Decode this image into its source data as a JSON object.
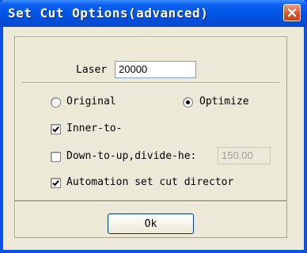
{
  "window": {
    "title": "Set Cut Options(advanced)",
    "close_icon": "close-icon"
  },
  "laser": {
    "label": "Laser",
    "value": "20000"
  },
  "mode": {
    "options": [
      {
        "label": "Original",
        "selected": false
      },
      {
        "label": "Optimize",
        "selected": true
      }
    ]
  },
  "options": {
    "inner_to": {
      "label": "Inner-to-",
      "checked": true
    },
    "down_to_up": {
      "label": "Down-to-up,divide-he:",
      "checked": false,
      "value": "150.00"
    },
    "automation": {
      "label": "Automation set cut director",
      "checked": true
    }
  },
  "ok_button": {
    "label": "Ok"
  },
  "colors": {
    "titlebar": "#0053e1",
    "dialog_bg": "#ece9d8",
    "close_button": "#e0522b"
  }
}
